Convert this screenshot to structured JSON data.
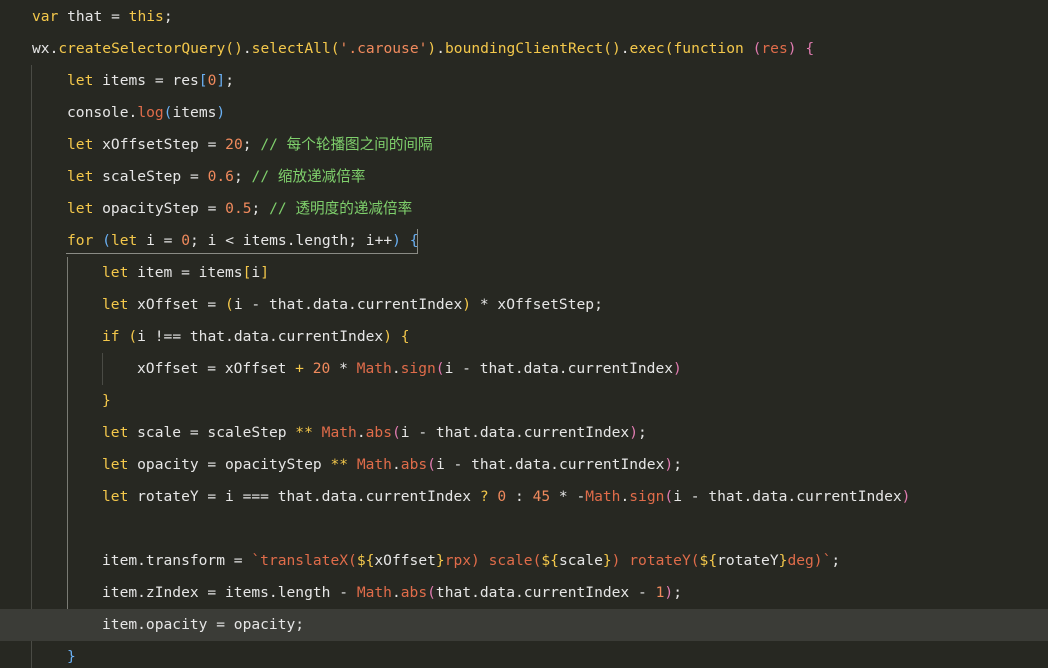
{
  "editor": {
    "current_line_index": 19,
    "lines": [
      {
        "indent": 1,
        "tokens": [
          [
            "var",
            "kw"
          ],
          [
            " that ",
            "plain"
          ],
          [
            "=",
            "plain"
          ],
          [
            " ",
            "plain"
          ],
          [
            "this",
            "kw"
          ],
          [
            ";",
            "plain"
          ]
        ]
      },
      {
        "indent": 1,
        "tokens": [
          [
            "wx.",
            "plain"
          ],
          [
            "createSelectorQuery",
            "fn"
          ],
          [
            "()",
            "paren"
          ],
          [
            ".",
            "plain"
          ],
          [
            "selectAll",
            "fn"
          ],
          [
            "(",
            "paren"
          ],
          [
            "'.carouse'",
            "str"
          ],
          [
            ")",
            "paren"
          ],
          [
            ".",
            "plain"
          ],
          [
            "boundingClientRect",
            "fn"
          ],
          [
            "()",
            "paren"
          ],
          [
            ".",
            "plain"
          ],
          [
            "exec",
            "fn"
          ],
          [
            "(",
            "paren"
          ],
          [
            "function",
            "kw"
          ],
          [
            " ",
            "plain"
          ],
          [
            "(",
            "paren2"
          ],
          [
            "res",
            "obj"
          ],
          [
            ")",
            "paren2"
          ],
          [
            " ",
            "plain"
          ],
          [
            "{",
            "paren2"
          ]
        ]
      },
      {
        "indent": 2,
        "tokens": [
          [
            "let",
            "kw"
          ],
          [
            " items = res",
            "plain"
          ],
          [
            "[",
            "paren3"
          ],
          [
            "0",
            "num"
          ],
          [
            "]",
            "paren3"
          ],
          [
            ";",
            "plain"
          ]
        ]
      },
      {
        "indent": 2,
        "tokens": [
          [
            "console",
            "plain"
          ],
          [
            ".",
            "plain"
          ],
          [
            "log",
            "obj"
          ],
          [
            "(",
            "paren3"
          ],
          [
            "items",
            "plain"
          ],
          [
            ")",
            "paren3"
          ]
        ]
      },
      {
        "indent": 2,
        "tokens": [
          [
            "let",
            "kw"
          ],
          [
            " xOffsetStep = ",
            "plain"
          ],
          [
            "20",
            "num"
          ],
          [
            "; ",
            "plain"
          ],
          [
            "// 每个轮播图之间的间隔",
            "cmt"
          ]
        ]
      },
      {
        "indent": 2,
        "tokens": [
          [
            "let",
            "kw"
          ],
          [
            " scaleStep = ",
            "plain"
          ],
          [
            "0.6",
            "num"
          ],
          [
            "; ",
            "plain"
          ],
          [
            "// 缩放递减倍率",
            "cmt"
          ]
        ]
      },
      {
        "indent": 2,
        "tokens": [
          [
            "let",
            "kw"
          ],
          [
            " opacityStep = ",
            "plain"
          ],
          [
            "0.5",
            "num"
          ],
          [
            "; ",
            "plain"
          ],
          [
            "// 透明度的递减倍率",
            "cmt"
          ]
        ]
      },
      {
        "indent": 2,
        "tokens": [
          [
            "for",
            "kw"
          ],
          [
            " ",
            "plain"
          ],
          [
            "(",
            "paren3"
          ],
          [
            "let",
            "kw"
          ],
          [
            " i = ",
            "plain"
          ],
          [
            "0",
            "num"
          ],
          [
            "; i ",
            "plain"
          ],
          [
            "<",
            "plain"
          ],
          [
            " items.length; i++",
            "plain"
          ],
          [
            ")",
            "paren3"
          ],
          [
            " ",
            "plain"
          ],
          [
            "{",
            "paren3"
          ]
        ]
      },
      {
        "indent": 3,
        "tokens": [
          [
            "let",
            "kw"
          ],
          [
            " item = items",
            "plain"
          ],
          [
            "[",
            "paren"
          ],
          [
            "i",
            "plain"
          ],
          [
            "]",
            "paren"
          ]
        ]
      },
      {
        "indent": 3,
        "tokens": [
          [
            "let",
            "kw"
          ],
          [
            " xOffset = ",
            "plain"
          ],
          [
            "(",
            "paren"
          ],
          [
            "i - that.data.currentIndex",
            "plain"
          ],
          [
            ")",
            "paren"
          ],
          [
            " * xOffsetStep;",
            "plain"
          ]
        ]
      },
      {
        "indent": 3,
        "tokens": [
          [
            "if",
            "kw"
          ],
          [
            " ",
            "plain"
          ],
          [
            "(",
            "paren"
          ],
          [
            "i !== that.data.currentIndex",
            "plain"
          ],
          [
            ")",
            "paren"
          ],
          [
            " ",
            "plain"
          ],
          [
            "{",
            "paren"
          ]
        ]
      },
      {
        "indent": 4,
        "tokens": [
          [
            "xOffset = xOffset ",
            "plain"
          ],
          [
            "+ ",
            "op"
          ],
          [
            "20",
            "num"
          ],
          [
            " * ",
            "plain"
          ],
          [
            "Math",
            "obj"
          ],
          [
            ".",
            "plain"
          ],
          [
            "sign",
            "obj"
          ],
          [
            "(",
            "paren2"
          ],
          [
            "i - that.data.currentIndex",
            "plain"
          ],
          [
            ")",
            "paren2"
          ]
        ]
      },
      {
        "indent": 3,
        "tokens": [
          [
            "}",
            "paren"
          ]
        ]
      },
      {
        "indent": 3,
        "tokens": [
          [
            "let",
            "kw"
          ],
          [
            " scale = scaleStep ",
            "plain"
          ],
          [
            "**",
            "op"
          ],
          [
            " ",
            "plain"
          ],
          [
            "Math",
            "obj"
          ],
          [
            ".",
            "plain"
          ],
          [
            "abs",
            "obj"
          ],
          [
            "(",
            "paren2"
          ],
          [
            "i - that.data.currentIndex",
            "plain"
          ],
          [
            ")",
            "paren2"
          ],
          [
            ";",
            "plain"
          ]
        ]
      },
      {
        "indent": 3,
        "tokens": [
          [
            "let",
            "kw"
          ],
          [
            " opacity = opacityStep ",
            "plain"
          ],
          [
            "**",
            "op"
          ],
          [
            " ",
            "plain"
          ],
          [
            "Math",
            "obj"
          ],
          [
            ".",
            "plain"
          ],
          [
            "abs",
            "obj"
          ],
          [
            "(",
            "paren2"
          ],
          [
            "i - that.data.currentIndex",
            "plain"
          ],
          [
            ")",
            "paren2"
          ],
          [
            ";",
            "plain"
          ]
        ]
      },
      {
        "indent": 3,
        "tokens": [
          [
            "let",
            "kw"
          ],
          [
            " rotateY = i === that.data.currentIndex ",
            "plain"
          ],
          [
            "?",
            "op"
          ],
          [
            " ",
            "plain"
          ],
          [
            "0",
            "num"
          ],
          [
            " : ",
            "plain"
          ],
          [
            "45",
            "num"
          ],
          [
            " * -",
            "plain"
          ],
          [
            "Math",
            "obj"
          ],
          [
            ".",
            "plain"
          ],
          [
            "sign",
            "obj"
          ],
          [
            "(",
            "paren2"
          ],
          [
            "i - that.data.currentIndex",
            "plain"
          ],
          [
            ")",
            "paren2"
          ]
        ]
      },
      {
        "indent": 3,
        "tokens": []
      },
      {
        "indent": 3,
        "tokens": [
          [
            "item.transform = ",
            "plain"
          ],
          [
            "`translateX(",
            "tpl"
          ],
          [
            "${",
            "paren"
          ],
          [
            "xOffset",
            "plain"
          ],
          [
            "}",
            "paren"
          ],
          [
            "rpx) scale(",
            "tpl"
          ],
          [
            "${",
            "paren"
          ],
          [
            "scale",
            "plain"
          ],
          [
            "}",
            "paren"
          ],
          [
            ") rotateY(",
            "tpl"
          ],
          [
            "${",
            "paren"
          ],
          [
            "rotateY",
            "plain"
          ],
          [
            "}",
            "paren"
          ],
          [
            "deg)`",
            "tpl"
          ],
          [
            ";",
            "plain"
          ]
        ]
      },
      {
        "indent": 3,
        "tokens": [
          [
            "item.zIndex = items.length ",
            "plain"
          ],
          [
            "- ",
            "plain"
          ],
          [
            "Math",
            "obj"
          ],
          [
            ".",
            "plain"
          ],
          [
            "abs",
            "obj"
          ],
          [
            "(",
            "paren2"
          ],
          [
            "that.data.currentIndex ",
            "plain"
          ],
          [
            "- ",
            "plain"
          ],
          [
            "1",
            "num"
          ],
          [
            ")",
            "paren2"
          ],
          [
            ";",
            "plain"
          ]
        ]
      },
      {
        "indent": 3,
        "tokens": [
          [
            "item.opacity = opacity;",
            "plain"
          ]
        ]
      },
      {
        "indent": 2,
        "tokens": [
          [
            "}",
            "paren3"
          ]
        ]
      }
    ]
  }
}
